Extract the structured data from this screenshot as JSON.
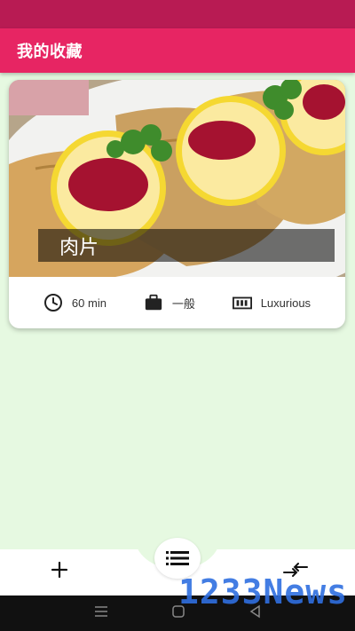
{
  "app_bar": {
    "title": "我的收藏"
  },
  "card": {
    "title": "肉片",
    "duration": "60 min",
    "complexity": "一般",
    "affordability": "Luxurious",
    "icons": {
      "duration": "clock-icon",
      "complexity": "briefcase-icon",
      "affordability": "money-icon"
    }
  },
  "bottom_nav": {
    "icons": [
      "add-icon",
      "list-icon",
      "compare-icon"
    ]
  },
  "system_nav": {
    "icons": [
      "menu-icon",
      "home-icon",
      "back-icon"
    ]
  },
  "watermark": "1233News",
  "colors": {
    "primary": "#e72563",
    "status": "#b81b53",
    "background": "#e6f9e1"
  }
}
